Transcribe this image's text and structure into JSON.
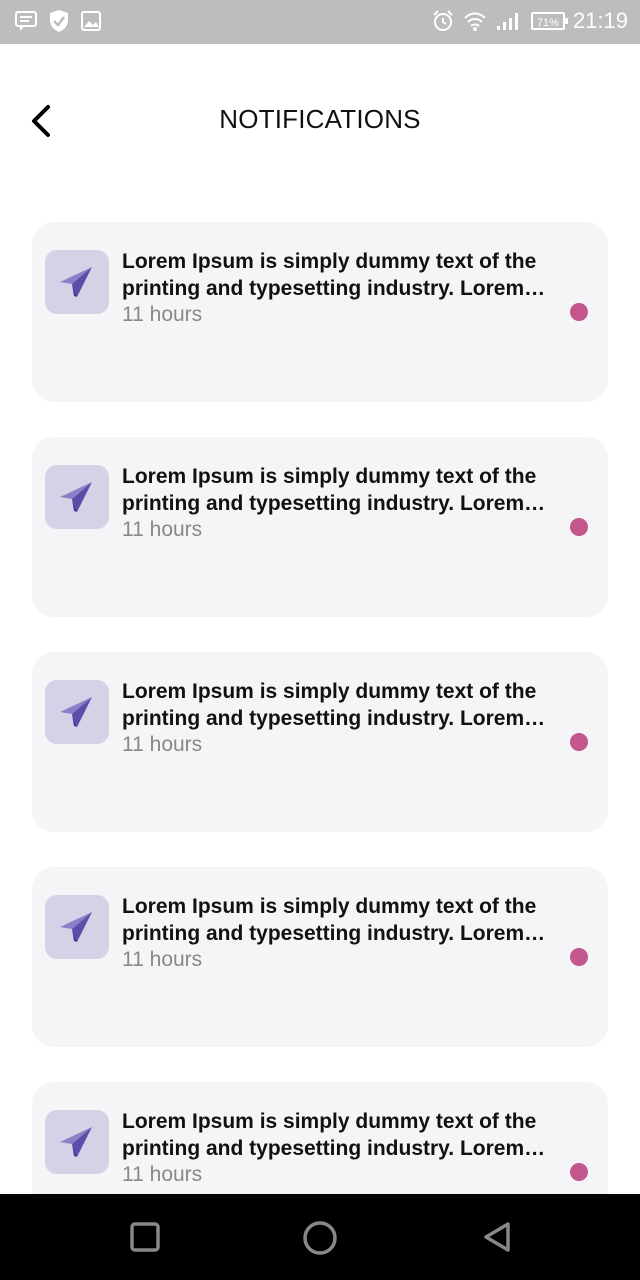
{
  "status_bar": {
    "time": "21:19",
    "battery": "71%",
    "left_icons": [
      "message-icon",
      "shield-icon",
      "image-icon"
    ],
    "right_icons": [
      "alarm-icon",
      "wifi-icon",
      "signal-icon",
      "battery-icon"
    ]
  },
  "header": {
    "title": "NOTIFICATIONS",
    "back_icon": "chevron-left-icon"
  },
  "notifications": [
    {
      "message": "Lorem Ipsum is simply dummy text of the printing and typesetting industry. Lorem Ipsum has been the industry's standard dummy text",
      "time": "11 hours",
      "unread": true
    },
    {
      "message": "Lorem Ipsum is simply dummy text of the printing and typesetting industry. Lorem Ipsum has been the industry's standard dummy text",
      "time": "11 hours",
      "unread": true
    },
    {
      "message": "Lorem Ipsum is simply dummy text of the printing and typesetting industry. Lorem Ipsum has been the industry's standard dummy text",
      "time": "11 hours",
      "unread": true
    },
    {
      "message": "Lorem Ipsum is simply dummy text of the printing and typesetting industry. Lorem Ipsum has been the industry's standard dummy text",
      "time": "11 hours",
      "unread": true
    },
    {
      "message": "Lorem Ipsum is simply dummy text of the printing and typesetting industry. Lorem Ipsum has been the industry's standard dummy text",
      "time": "11 hours",
      "unread": true
    }
  ],
  "colors": {
    "accent_dot": "#c3578d",
    "icon_bg": "#d5d2e8",
    "icon_fg": "#6a5fb0",
    "card_bg": "#f5f5f7",
    "status_bar_bg": "#bdbdbd"
  },
  "nav_bar": {
    "buttons": [
      "recent-apps-icon",
      "home-icon",
      "back-icon"
    ]
  }
}
